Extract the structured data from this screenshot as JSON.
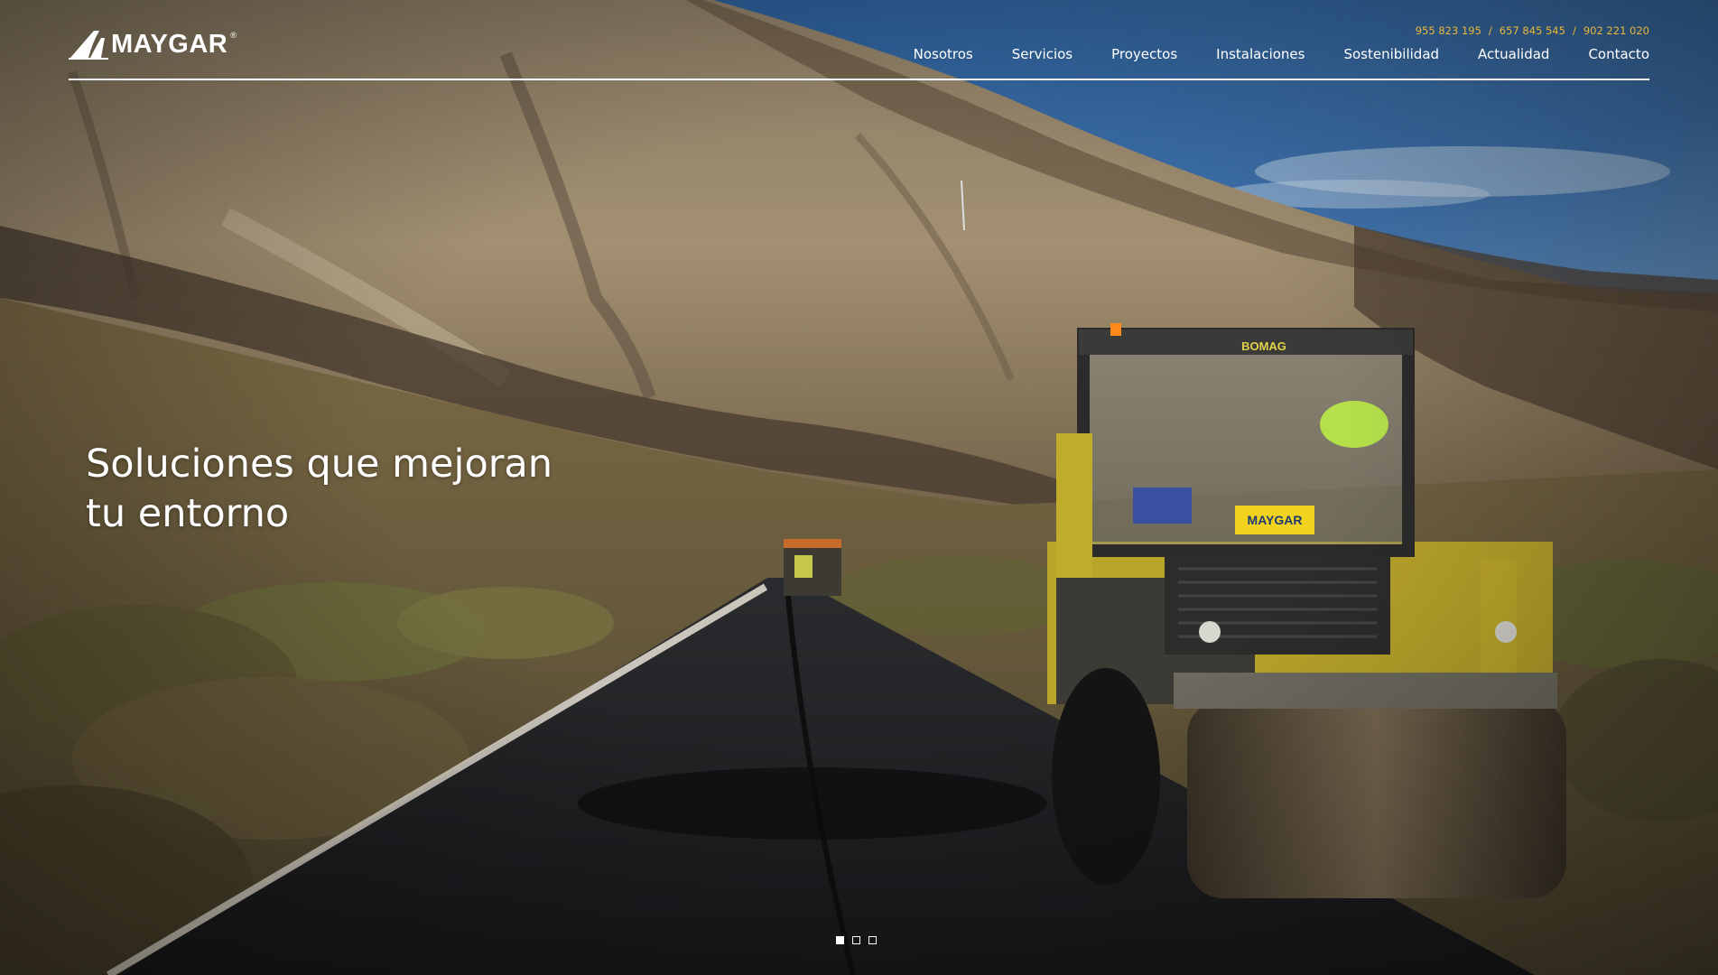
{
  "brand": {
    "name": "MAYGAR",
    "registered": "®"
  },
  "contact": {
    "phones": [
      "955 823 195",
      "657 845 545",
      "902 221 020"
    ],
    "separator": "/",
    "color": "#e8b73a"
  },
  "nav": {
    "items": [
      {
        "label": "Nosotros"
      },
      {
        "label": "Servicios"
      },
      {
        "label": "Proyectos"
      },
      {
        "label": "Instalaciones"
      },
      {
        "label": "Sostenibilidad"
      },
      {
        "label": "Actualidad"
      },
      {
        "label": "Contacto"
      }
    ]
  },
  "hero": {
    "headline_line1": "Soluciones que mejoran",
    "headline_line2": "tu entorno",
    "slides": 3,
    "active_slide": 1
  }
}
